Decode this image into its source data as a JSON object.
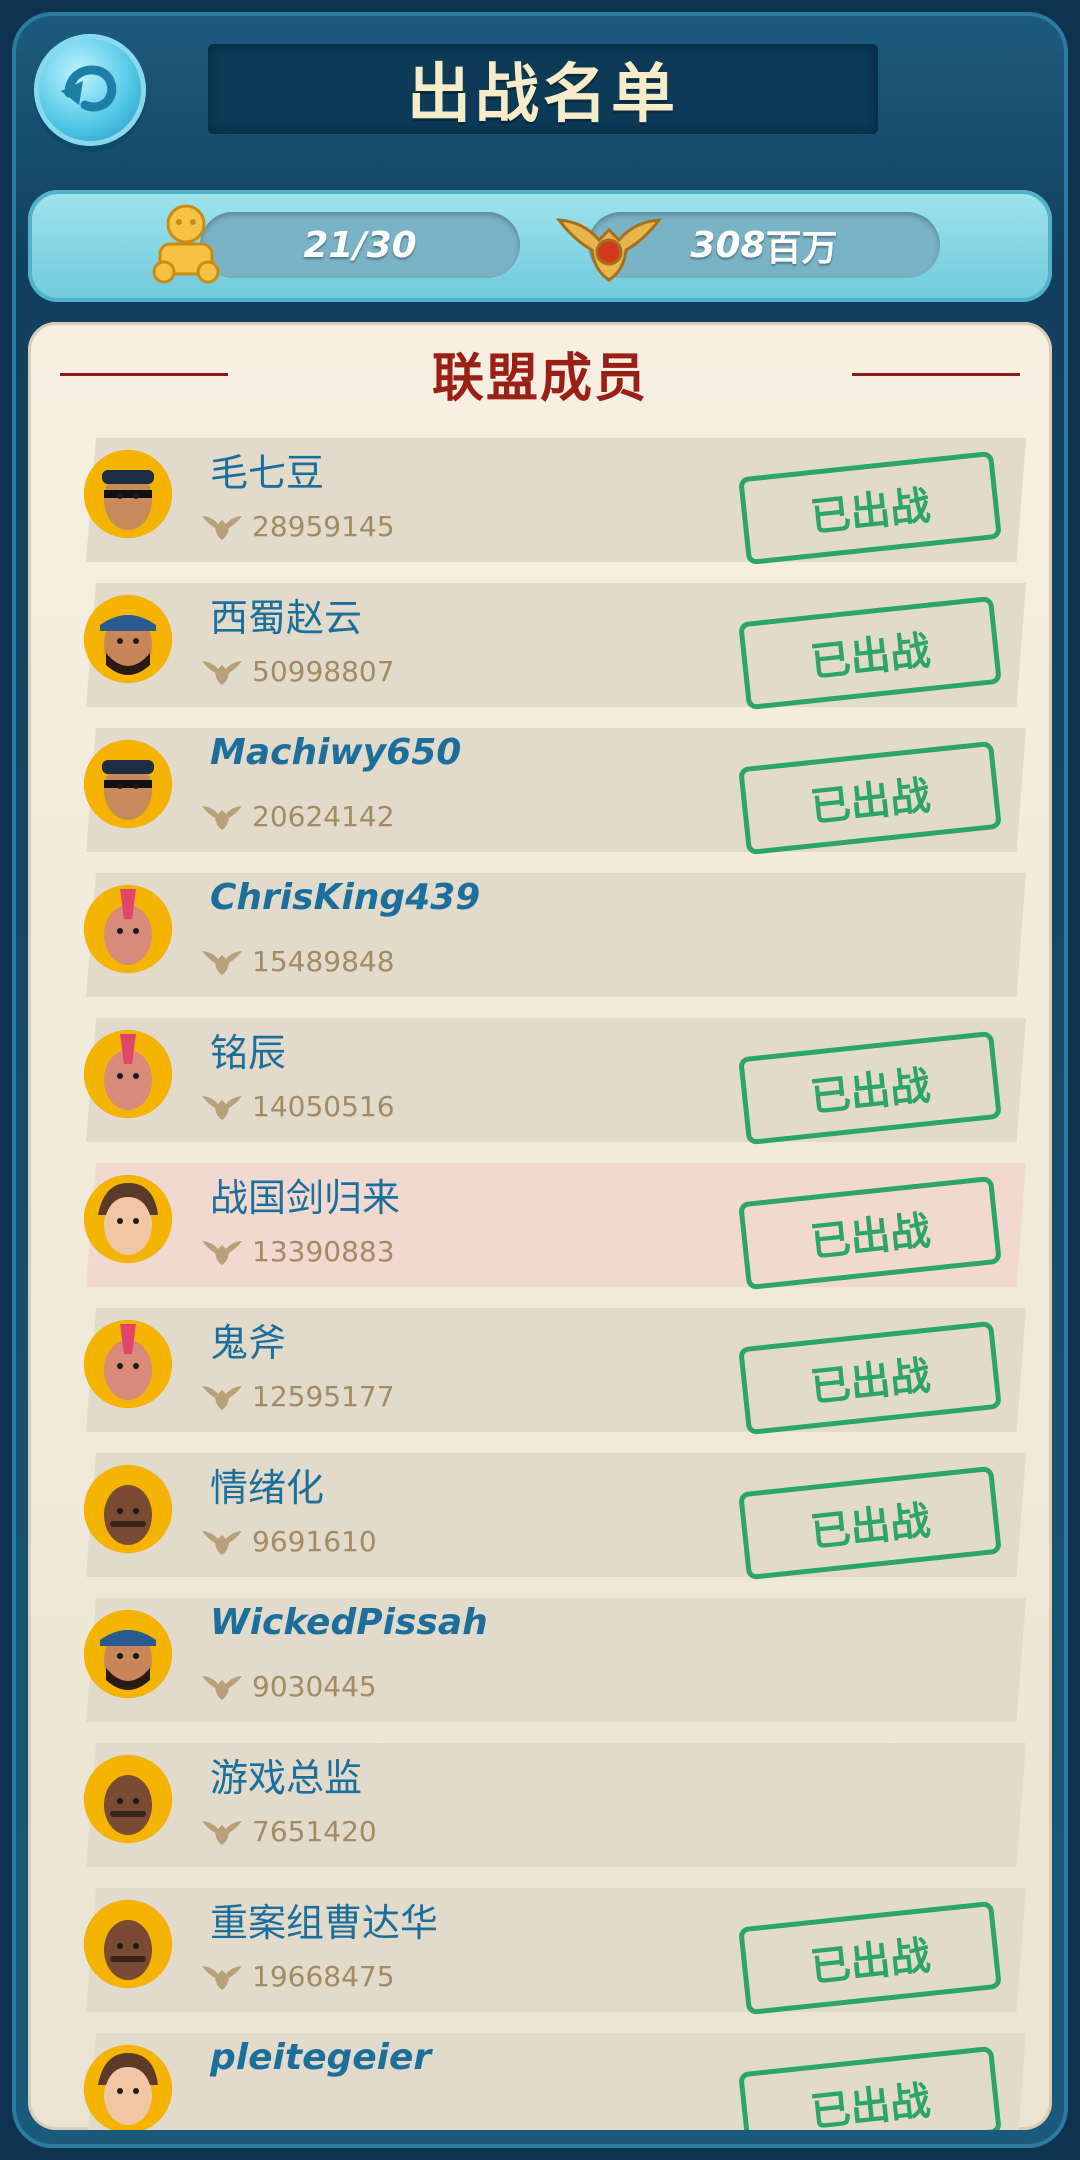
{
  "header": {
    "title": "出战名单",
    "back_icon": "back-arrow-icon"
  },
  "stats": {
    "members": "21/30",
    "power_value": "308",
    "power_unit": "百万"
  },
  "section": {
    "title": "联盟成员"
  },
  "members": [
    {
      "name": "毛七豆",
      "power": "28959145",
      "deployed": true,
      "stamp": "已出战",
      "avatar": "pirate-cap-avatar",
      "latin": false,
      "highlight": false
    },
    {
      "name": "西蜀赵云",
      "power": "50998807",
      "deployed": true,
      "stamp": "已出战",
      "avatar": "bandana-bearded-avatar",
      "latin": false,
      "highlight": false
    },
    {
      "name": "Machiwy650",
      "power": "20624142",
      "deployed": true,
      "stamp": "已出战",
      "avatar": "pirate-cap-avatar",
      "latin": true,
      "highlight": false
    },
    {
      "name": "ChrisKing439",
      "power": "15489848",
      "deployed": false,
      "stamp": "",
      "avatar": "mohawk-avatar",
      "latin": true,
      "highlight": false
    },
    {
      "name": "铭辰",
      "power": "14050516",
      "deployed": true,
      "stamp": "已出战",
      "avatar": "mohawk-avatar",
      "latin": false,
      "highlight": false
    },
    {
      "name": "战国剑归来",
      "power": "13390883",
      "deployed": true,
      "stamp": "已出战",
      "avatar": "woman-avatar",
      "latin": false,
      "highlight": true
    },
    {
      "name": "鬼斧",
      "power": "12595177",
      "deployed": true,
      "stamp": "已出战",
      "avatar": "mohawk-avatar",
      "latin": false,
      "highlight": false
    },
    {
      "name": "情绪化",
      "power": "9691610",
      "deployed": true,
      "stamp": "已出战",
      "avatar": "bald-man-avatar",
      "latin": false,
      "highlight": false
    },
    {
      "name": "WickedPissah",
      "power": "9030445",
      "deployed": false,
      "stamp": "",
      "avatar": "bandana-bearded-avatar",
      "latin": true,
      "highlight": false
    },
    {
      "name": "游戏总监",
      "power": "7651420",
      "deployed": false,
      "stamp": "",
      "avatar": "bald-man-avatar",
      "latin": false,
      "highlight": false
    },
    {
      "name": "重案组曹达华",
      "power": "19668475",
      "deployed": true,
      "stamp": "已出战",
      "avatar": "bald-man-avatar",
      "latin": false,
      "highlight": false
    },
    {
      "name": "pleitegeier",
      "power": "",
      "deployed": true,
      "stamp": "已出战",
      "avatar": "woman-avatar",
      "latin": true,
      "highlight": false
    }
  ]
}
